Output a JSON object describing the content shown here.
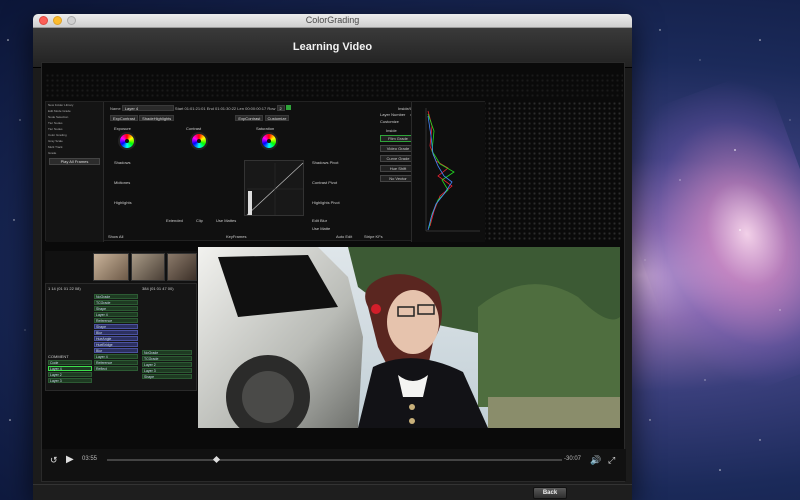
{
  "window": {
    "title": "ColorGrading"
  },
  "header": {
    "title": "Learning Video"
  },
  "app_ui": {
    "left_lines": [
      "New   Folder   Library",
      "Edit Mode   Grade",
      "Node   Selection",
      "Tier Nodes",
      "Tier Nodes",
      "Color Grading",
      "Gray Scale",
      "Multi Track",
      "Grade"
    ],
    "left_button": "Play All Frames",
    "name_label": "Name",
    "name_value": "Layer 4",
    "start_label": "Start",
    "start_value": "01:01:21:01",
    "end_label": "End",
    "end_value": "01:01:30:22",
    "len_label": "Len",
    "len_value": "00:00:00:17",
    "row_label": "Row",
    "row_value": "2",
    "tabs": [
      "ExpContrast",
      "ShadeHighlights",
      "ExpContrast",
      "Customize"
    ],
    "sections": [
      "Exposure",
      "Contrast",
      "Saturation",
      "Shadows",
      "Midtones",
      "Highlights",
      "Shadows Pivot",
      "Contrast Pivot",
      "Highlights Pivot"
    ],
    "inside_outside": "Inside/Outside",
    "layer_number_label": "Layer Number",
    "layer_number_value": "4",
    "customize": "Customize",
    "inside_label": "Inside",
    "outside_label": "Outside",
    "inside_buttons": [
      "Film Grade",
      "Video Grade",
      "Curve Grade",
      "Hue Shift",
      "No Vector"
    ],
    "outside_buttons": [
      "Film Grade",
      "Video Grade",
      "Curve Grade",
      "Hue Shift",
      "No Vector"
    ],
    "bottom_buttons": [
      "Extended",
      "Clip",
      "Use Mattes",
      "Edit Blur",
      "Use Matte",
      "Auto Edit",
      "Stripe KFs",
      "Show All"
    ],
    "keyframes_label": "KeyFrames",
    "timecode_a": "1 14 (01 01 22 08)",
    "timecode_b": "384 (01 01 47 00)",
    "track_items_a": [
      "NoGrade",
      "TCGrade",
      "Shape",
      "Layer 4",
      "Reference",
      "Shape",
      "Blur",
      "HueAngle",
      "HueBridge",
      "Blur",
      "Layer 4",
      "Reference",
      "Reflect"
    ],
    "track_items_b": [
      "NoGrade",
      "TCGrade",
      "Layer 2",
      "Layer 3",
      "Shape"
    ],
    "track_items_c": [
      "Code",
      "Layer 4",
      "Layer 2",
      "Layer 3"
    ],
    "comment_label": "COMMENT"
  },
  "player": {
    "elapsed": "03:55",
    "remaining": "-30:07",
    "progress_fraction": 0.235,
    "icons": [
      "replay-30-icon",
      "play-icon",
      "volume-icon",
      "fullscreen-icon"
    ]
  },
  "footer": {
    "back_label": "Back"
  },
  "colors": {
    "accent_green": "#2fa43a",
    "window_bg": "#1b1b1b",
    "header_text": "#f2f2f2"
  }
}
